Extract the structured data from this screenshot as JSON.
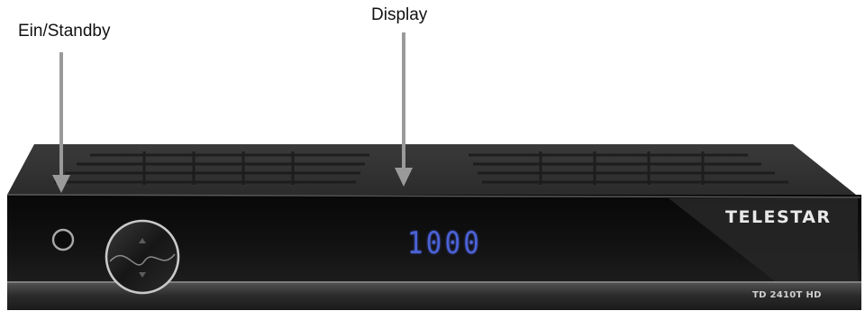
{
  "callouts": {
    "power_label": "Ein/Standby",
    "display_label": "Display"
  },
  "device": {
    "brand": "TELESTAR",
    "model": "TD 2410T HD",
    "display_value": "1000"
  },
  "colors": {
    "arrow": "#9a9a9a",
    "display_glow": "#4b62d6",
    "body_dark": "#151515"
  }
}
